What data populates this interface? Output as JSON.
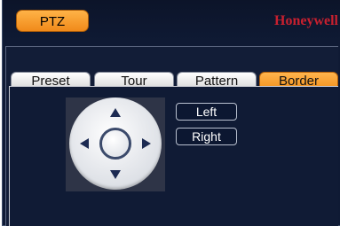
{
  "header": {
    "active_module": "PTZ",
    "brand": "Honeywell"
  },
  "tabs": [
    {
      "label": "Preset",
      "active": false
    },
    {
      "label": "Tour",
      "active": false
    },
    {
      "label": "Pattern",
      "active": false
    },
    {
      "label": "Border",
      "active": true
    }
  ],
  "border_controls": {
    "left_label": "Left",
    "right_label": "Right"
  },
  "colors": {
    "accent": "#f39320",
    "brand": "#c8202f",
    "background": "#0f1a34"
  },
  "icons": [
    "arrow-up-icon",
    "arrow-down-icon",
    "arrow-left-icon",
    "arrow-right-icon",
    "center-ring-icon"
  ]
}
